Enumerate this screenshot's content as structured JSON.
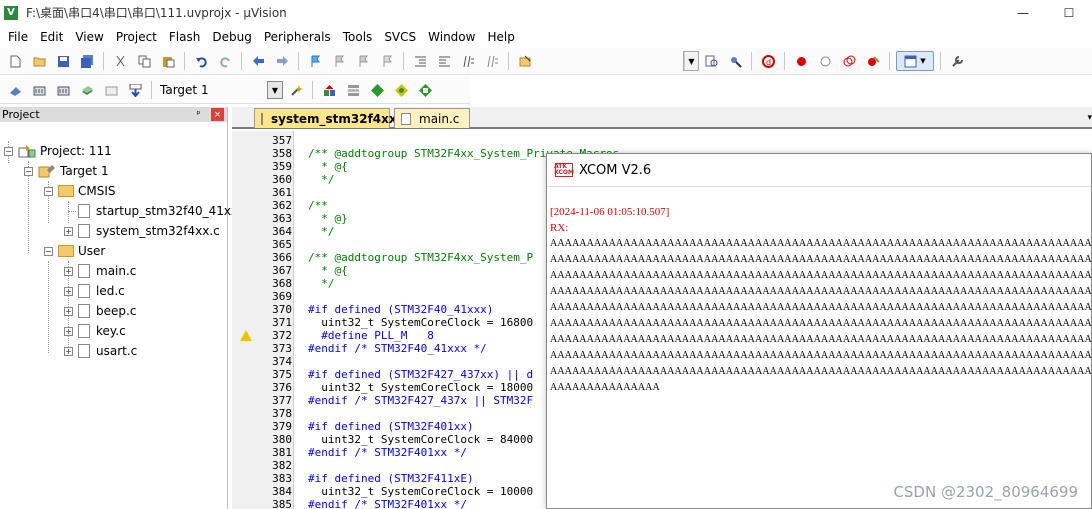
{
  "window": {
    "title": "F:\\桌面\\串口4\\串口\\串口\\111.uvprojx - µVision",
    "min": "—",
    "max": "☐"
  },
  "menu": [
    "File",
    "Edit",
    "View",
    "Project",
    "Flash",
    "Debug",
    "Peripherals",
    "Tools",
    "SVCS",
    "Window",
    "Help"
  ],
  "toolbar2": {
    "target": "Target 1"
  },
  "project_panel": {
    "title": "Project",
    "pin": "ᵖ",
    "close": "×",
    "root": "Project: 111",
    "target": "Target 1",
    "group1": "CMSIS",
    "cmsis_files": [
      "startup_stm32f40_41xxx",
      "system_stm32f4xx.c"
    ],
    "group2": "User",
    "user_files": [
      "main.c",
      "led.c",
      "beep.c",
      "key.c",
      "usart.c"
    ]
  },
  "editor": {
    "tabs": [
      "system_stm32f4xx.c",
      "main.c"
    ],
    "lines": [
      {
        "n": "357",
        "t": ""
      },
      {
        "n": "358",
        "t": "/** @addtogroup STM32F4xx_System_Private_Macros"
      },
      {
        "n": "359",
        "t": "  * @{"
      },
      {
        "n": "360",
        "t": "  */"
      },
      {
        "n": "361",
        "t": ""
      },
      {
        "n": "362",
        "t": "/**"
      },
      {
        "n": "363",
        "t": "  * @}"
      },
      {
        "n": "364",
        "t": "  */"
      },
      {
        "n": "365",
        "t": ""
      },
      {
        "n": "366",
        "t": "/** @addtogroup STM32F4xx_System_P"
      },
      {
        "n": "367",
        "t": "  * @{"
      },
      {
        "n": "368",
        "t": "  */"
      },
      {
        "n": "369",
        "t": ""
      },
      {
        "n": "370",
        "t": "#if defined (STM32F40_41xxx)"
      },
      {
        "n": "371",
        "t": "  uint32_t SystemCoreClock = 16800"
      },
      {
        "n": "372",
        "t": "  #define PLL_M   8"
      },
      {
        "n": "373",
        "t": "#endif /* STM32F40_41xxx */"
      },
      {
        "n": "374",
        "t": ""
      },
      {
        "n": "375",
        "t": "#if defined (STM32F427_437xx) || d"
      },
      {
        "n": "376",
        "t": "  uint32_t SystemCoreClock = 18000"
      },
      {
        "n": "377",
        "t": "#endif /* STM32F427_437x || STM32F"
      },
      {
        "n": "378",
        "t": ""
      },
      {
        "n": "379",
        "t": "#if defined (STM32F401xx)"
      },
      {
        "n": "380",
        "t": "  uint32_t SystemCoreClock = 84000"
      },
      {
        "n": "381",
        "t": "#endif /* STM32F401xx */"
      },
      {
        "n": "382",
        "t": ""
      },
      {
        "n": "383",
        "t": "#if defined (STM32F411xE)"
      },
      {
        "n": "384",
        "t": "  uint32_t SystemCoreClock = 10000"
      },
      {
        "n": "385",
        "t": "#endif /* STM32F401xx */"
      }
    ]
  },
  "xcom": {
    "logo": "ATK XCOM",
    "title": "XCOM V2.6",
    "timestamp": "[2024-11-06 01:05:10.507]",
    "rx": "RX:",
    "rows": [
      "AAAAAAAAAAAAAAAAAAAAAAAAAAAAAAAAAAAAAAAAAAAAAAAAAAAAAAAAAAAAAAAAAAAAAAAAAAAA",
      "AAAAAAAAAAAAAAAAAAAAAAAAAAAAAAAAAAAAAAAAAAAAAAAAAAAAAAAAAAAAAAAAAAAAAAAAAAAA",
      "AAAAAAAAAAAAAAAAAAAAAAAAAAAAAAAAAAAAAAAAAAAAAAAAAAAAAAAAAAAAAAAAAAAAAAAAAAAA",
      "AAAAAAAAAAAAAAAAAAAAAAAAAAAAAAAAAAAAAAAAAAAAAAAAAAAAAAAAAAAAAAAAAAAAAAAAAAAA",
      "AAAAAAAAAAAAAAAAAAAAAAAAAAAAAAAAAAAAAAAAAAAAAAAAAAAAAAAAAAAAAAAAAAAAAAAAAAAA",
      "AAAAAAAAAAAAAAAAAAAAAAAAAAAAAAAAAAAAAAAAAAAAAAAAAAAAAAAAAAAAAAAAAAAAAAAAAAAA",
      "AAAAAAAAAAAAAAAAAAAAAAAAAAAAAAAAAAAAAAAAAAAAAAAAAAAAAAAAAAAAAAAAAAAAAAAAAAAA",
      "AAAAAAAAAAAAAAAAAAAAAAAAAAAAAAAAAAAAAAAAAAAAAAAAAAAAAAAAAAAAAAAAAAAAAAAAAAAA",
      "AAAAAAAAAAAAAAAAAAAAAAAAAAAAAAAAAAAAAAAAAAAAAAAAAAAAAAAAAAAAAAAAAAAAAAAAAAAA",
      "AAAAAAAAAAAAAAA"
    ]
  },
  "watermark": "CSDN @2302_80964699",
  "colors": {
    "comment": "#007f00",
    "keyword": "#0000ff",
    "number": "#008080",
    "rx_red": "#d40000",
    "tab_active": "#fde58a"
  }
}
